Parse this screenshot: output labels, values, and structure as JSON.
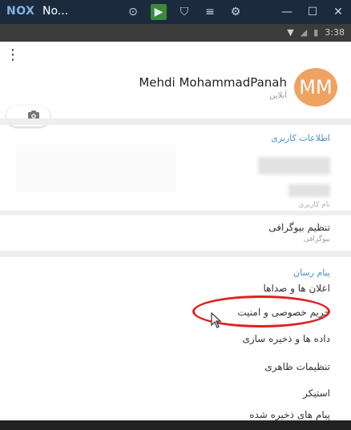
{
  "window": {
    "logo": "NOX",
    "title": "No...",
    "buttons": {
      "record": "⊙",
      "play": "▶",
      "shirt": "⛉",
      "menu": "≡",
      "settings": "⚙",
      "minimize": "—",
      "maximize": "☐",
      "close": "✕"
    }
  },
  "status_bar": {
    "wifi": "▼",
    "signal": "◢",
    "battery": "▮",
    "time": "3:38"
  },
  "profile": {
    "name": "Mehdi MohammadPanah",
    "status": "آنلاین",
    "avatar_initials": "MM",
    "avatar_color": "#f0a261"
  },
  "sections": {
    "user_info_header": "اطلاعات کاربری",
    "username_hint": "نام کاربری",
    "bio_title": "تنظیم بیوگرافی",
    "bio_sub": "بیوگرافی",
    "messenger_header": "پیام رسان",
    "items": [
      "اعلان ها و صداها",
      "حریم خصوصی و امنیت",
      "داده ها و ذخیره سازی",
      "تنظیمات ظاهری",
      "استیکر",
      "پیام های ذخیره شده"
    ]
  },
  "accent_color": "#4a8fcf",
  "highlight_color": "#e02020"
}
